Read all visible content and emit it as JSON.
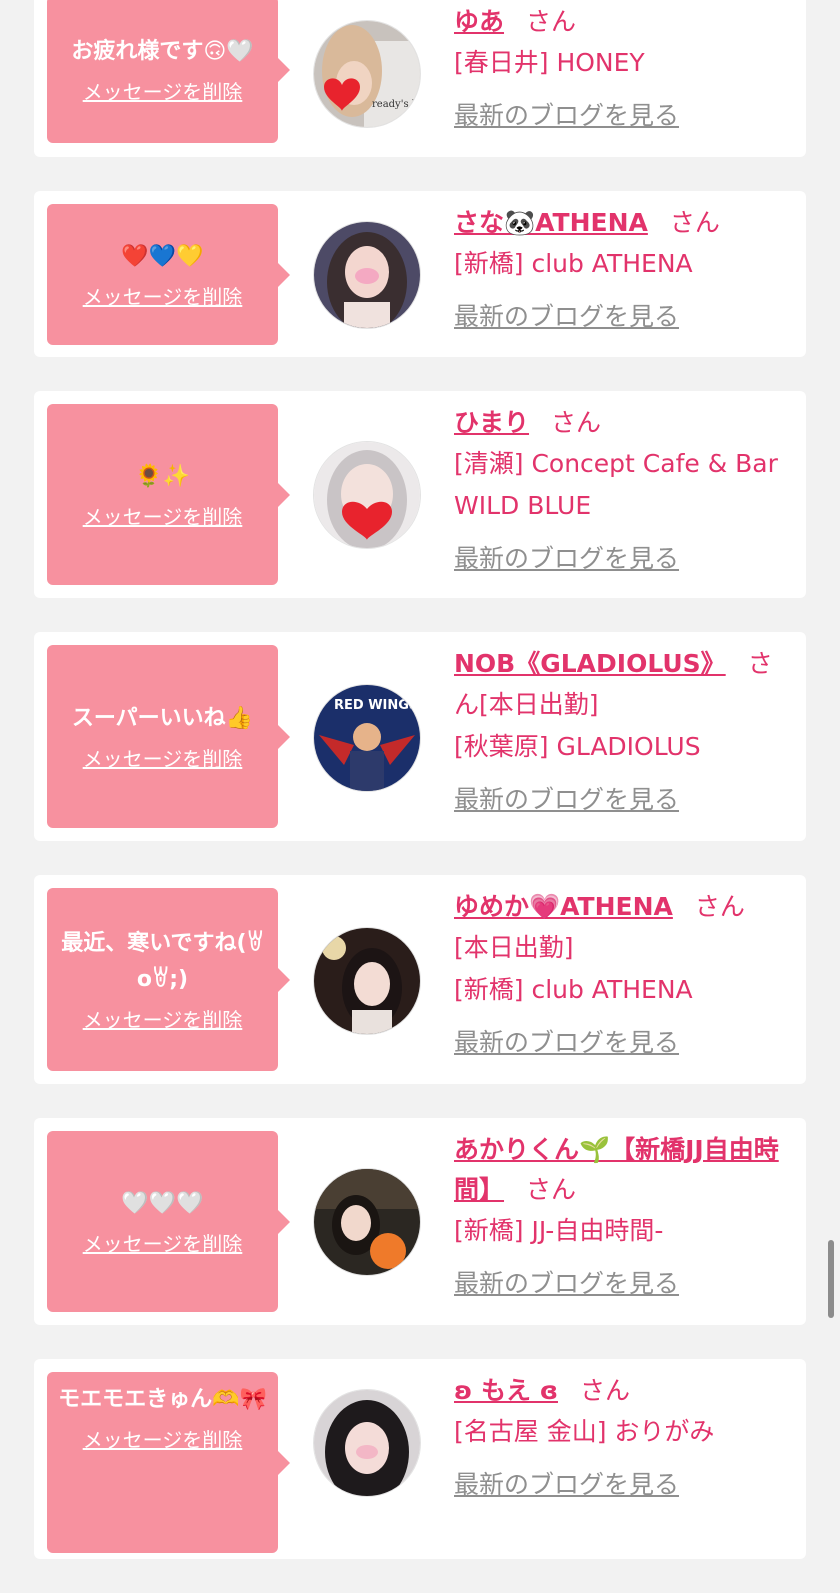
{
  "accent_color": "#e2336b",
  "bubble_color": "#f7919f",
  "delete_label": "メッセージを削除",
  "blog_label": "最新のブログを見る",
  "san_label": "さん",
  "cards": [
    {
      "message": "お疲れ様です🙃🤍",
      "name": "ゆあ",
      "shop": "[春日井] HONEY",
      "shop2": "",
      "avatar_icon": "avatar-photo"
    },
    {
      "message": "❤️💙💛",
      "name": "さな🐼ATHENA",
      "shop": "[新橋] club ATHENA",
      "shop2": "",
      "avatar_icon": "avatar-photo"
    },
    {
      "message": "🌻✨",
      "name": "ひまり",
      "shop": "[清瀬] Concept Cafe & Bar",
      "shop2": "WILD BLUE",
      "avatar_icon": "avatar-photo"
    },
    {
      "message": "スーパーいいね👍",
      "name": "NOB《GLADIOLUS》",
      "status": "[本日出勤]",
      "shop": "[秋葉原] GLADIOLUS",
      "shop2": "",
      "avatar_icon": "avatar-red-wings"
    },
    {
      "message": "最近、寒いですね(ꇐoꇐ;)",
      "name": "ゆめか💗ATHENA",
      "status": "[本日出勤]",
      "shop": "[新橋] club ATHENA",
      "shop2": "",
      "avatar_icon": "avatar-photo"
    },
    {
      "message": "🤍🤍🤍",
      "name": "あかりくん🌱【新橋JJ自由時間】",
      "shop": "[新橋] JJ-自由時間-",
      "shop2": "",
      "avatar_icon": "avatar-photo"
    },
    {
      "message": "モエモエきゅん🫶🎀",
      "name": "ʚ もえ ɞ",
      "shop": "[名古屋 金山] おりがみ",
      "shop2": "",
      "avatar_icon": "avatar-photo"
    }
  ]
}
